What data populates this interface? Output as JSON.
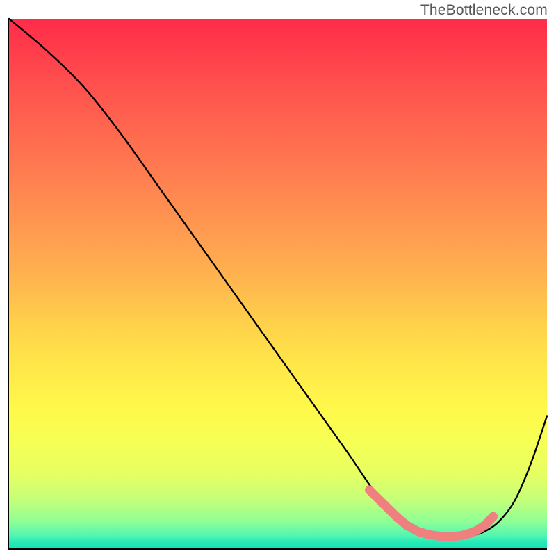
{
  "watermark": "TheBottleneck.com",
  "chart_data": {
    "type": "line",
    "title": "",
    "xlabel": "",
    "ylabel": "",
    "xlim": [
      0,
      100
    ],
    "ylim": [
      0,
      100
    ],
    "series": [
      {
        "name": "bottleneck-curve",
        "x": [
          0,
          7,
          14,
          21,
          28,
          35,
          42,
          49,
          56,
          63,
          67,
          70,
          73,
          76,
          79,
          82,
          85,
          88,
          91,
          94,
          97,
          100
        ],
        "y": [
          100,
          94,
          87,
          78,
          68,
          58,
          48,
          38,
          28,
          18,
          12,
          8,
          5,
          3.2,
          2.3,
          2.0,
          2.2,
          3.0,
          5.0,
          9.0,
          16,
          25
        ]
      }
    ],
    "markers": {
      "name": "highlight-dots",
      "color": "#f08080",
      "x": [
        67,
        69.5,
        72,
        74,
        76,
        78,
        80,
        82,
        84,
        85.5,
        87,
        88.5,
        90
      ],
      "y": [
        11,
        8.5,
        6,
        4.3,
        3.2,
        2.6,
        2.3,
        2.2,
        2.4,
        2.8,
        3.4,
        4.4,
        6.0
      ]
    }
  }
}
